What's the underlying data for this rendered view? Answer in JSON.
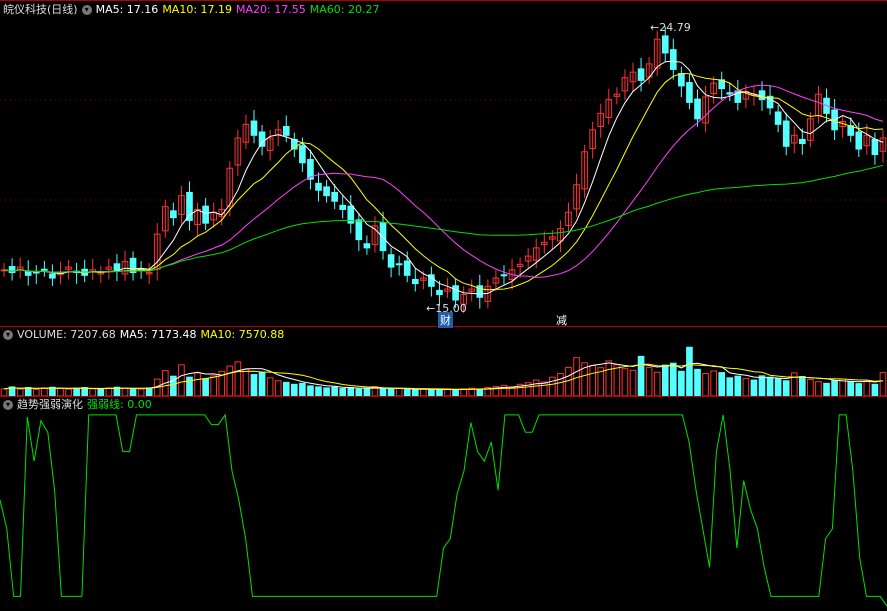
{
  "colors": {
    "background": "#000000",
    "up": "#ff3232",
    "down": "#54ffff",
    "ma5": "#ffffff",
    "ma10": "#ffff00",
    "ma20": "#ff40ff",
    "ma60": "#00e000",
    "strength": "#00e000",
    "grid": "#8b0000"
  },
  "main_panel": {
    "title": "皖仪科技(日线)",
    "ma5_label": "MA5: 17.16",
    "ma10_label": "MA10: 17.19",
    "ma20_label": "MA20: 17.55",
    "ma60_label": "MA60: 20.27",
    "high_label": "24.79",
    "low_label": "15.00",
    "event_marker_1": "财",
    "event_marker_2": "减"
  },
  "volume_panel": {
    "volume_label": "VOLUME: 7207.68",
    "ma5_label": "MA5: 7173.48",
    "ma10_label": "MA10: 7570.88"
  },
  "indicator_panel": {
    "title": "趋势强弱演化",
    "line_label": "强弱线: 0.00"
  },
  "chart_data": {
    "type": "candlestick",
    "price_range": [
      14.2,
      25.2
    ],
    "high": 24.79,
    "low": 15.0,
    "close_series": [
      16.1,
      16.0,
      16.2,
      15.9,
      16.0,
      16.1,
      15.8,
      16.0,
      16.2,
      16.0,
      15.9,
      16.1,
      16.0,
      16.2,
      16.1,
      16.4,
      16.0,
      16.1,
      16.0,
      17.4,
      18.4,
      18.0,
      18.8,
      17.9,
      18.3,
      17.8,
      18.2,
      18.3,
      19.8,
      20.9,
      21.4,
      21.0,
      20.6,
      20.9,
      21.2,
      21.0,
      20.5,
      20.0,
      19.4,
      19.0,
      18.8,
      18.6,
      18.3,
      17.8,
      17.2,
      16.9,
      17.7,
      16.8,
      16.2,
      16.3,
      15.9,
      15.6,
      15.8,
      15.5,
      15.2,
      15.4,
      15.0,
      15.2,
      15.4,
      15.1,
      15.5,
      15.8,
      15.9,
      16.1,
      16.3,
      16.6,
      16.9,
      17.1,
      17.3,
      17.6,
      18.2,
      19.2,
      20.4,
      21.2,
      21.8,
      22.3,
      22.5,
      23.1,
      23.3,
      23.0,
      23.6,
      24.5,
      24.0,
      23.4,
      22.8,
      22.2,
      21.6,
      22.4,
      22.9,
      22.7,
      22.5,
      22.2,
      22.6,
      22.5,
      22.3,
      22.0,
      21.4,
      20.6,
      21.0,
      20.7,
      21.6,
      22.5,
      21.8,
      21.2,
      21.5,
      21.0,
      20.5,
      21.0,
      20.3,
      20.9
    ],
    "volume_range": [
      0,
      16000
    ],
    "volume_series": [
      2200,
      2800,
      2100,
      2600,
      2000,
      2500,
      2700,
      2300,
      2100,
      2400,
      2600,
      2200,
      2000,
      2500,
      2700,
      2400,
      2300,
      2100,
      2500,
      5200,
      7800,
      6100,
      9600,
      5800,
      7100,
      5300,
      6200,
      7600,
      9200,
      10500,
      8200,
      6600,
      7300,
      5600,
      4700,
      4200,
      3600,
      3900,
      3100,
      2800,
      2500,
      2700,
      2300,
      2600,
      2100,
      2400,
      2900,
      2200,
      2000,
      2300,
      2100,
      1900,
      2200,
      2000,
      1800,
      2100,
      1900,
      2200,
      2400,
      2100,
      2600,
      2900,
      3300,
      2800,
      3600,
      4100,
      4900,
      4300,
      5800,
      6900,
      8800,
      11800,
      10200,
      9400,
      8700,
      10800,
      9600,
      8400,
      7900,
      12200,
      8800,
      7300,
      9500,
      10100,
      7600,
      15000,
      8200,
      6900,
      7700,
      7200,
      5600,
      6100,
      5400,
      4900,
      6200,
      5800,
      5300,
      4700,
      7100,
      6000,
      5100,
      4400,
      3900,
      4700,
      5200,
      4400,
      3800,
      4500,
      3600,
      7200
    ],
    "strength_range": [
      0,
      100
    ],
    "strength_series": [
      55,
      40,
      5,
      5,
      98,
      75,
      96,
      90,
      60,
      5,
      5,
      5,
      5,
      99,
      99,
      99,
      99,
      99,
      80,
      80,
      99,
      99,
      99,
      99,
      99,
      99,
      99,
      99,
      99,
      99,
      99,
      94,
      94,
      99,
      70,
      55,
      35,
      5,
      5,
      5,
      5,
      5,
      5,
      5,
      5,
      5,
      5,
      5,
      5,
      5,
      5,
      5,
      5,
      5,
      5,
      5,
      5,
      5,
      5,
      5,
      5,
      5,
      5,
      5,
      5,
      30,
      35,
      58,
      70,
      95,
      80,
      75,
      85,
      60,
      99,
      99,
      99,
      90,
      90,
      99,
      99,
      99,
      99,
      99,
      99,
      99,
      99,
      99,
      99,
      99,
      99,
      99,
      99,
      99,
      99,
      99,
      99,
      99,
      99,
      99,
      99,
      85,
      60,
      40,
      20,
      80,
      99,
      70,
      30,
      65,
      50,
      40,
      20,
      5,
      5,
      5,
      5,
      5,
      5,
      5,
      5,
      35,
      40,
      99,
      99,
      70,
      25,
      5,
      5,
      5,
      0
    ]
  }
}
